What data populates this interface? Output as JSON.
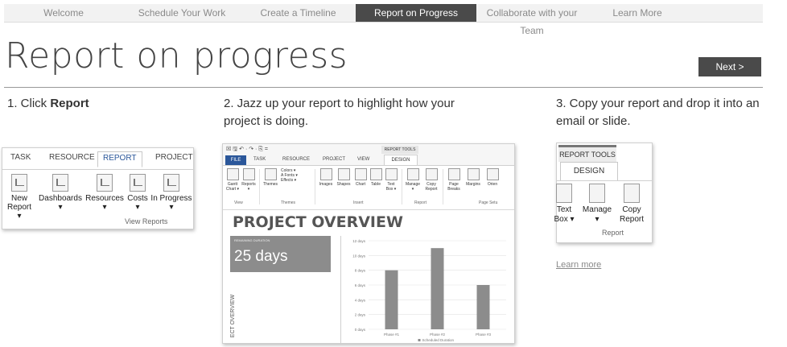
{
  "nav": {
    "tabs": [
      {
        "label": "Welcome"
      },
      {
        "label": "Schedule Your Work"
      },
      {
        "label": "Create a Timeline"
      },
      {
        "label": "Report on Progress",
        "active": true
      },
      {
        "label": "Collaborate with your Team"
      },
      {
        "label": "Learn More"
      }
    ]
  },
  "page": {
    "title": "Report on progress",
    "next_label": "Next >"
  },
  "steps": {
    "s1_prefix": "1. Click ",
    "s1_bold": "Report",
    "s2_line1": "2. Jazz up your report to highlight how your",
    "s2_line2": "project is doing.",
    "s3_line1": "3. Copy your report and drop it into an",
    "s3_line2": "email or slide."
  },
  "ribbon1": {
    "tabs": [
      "TASK",
      "RESOURCE",
      "REPORT",
      "PROJECT"
    ],
    "buttons": [
      {
        "line1": "New",
        "line2": "Report ▾"
      },
      {
        "line1": "Dashboards",
        "line2": "▾"
      },
      {
        "line1": "Resources",
        "line2": "▾"
      },
      {
        "line1": "Costs",
        "line2": "▾"
      },
      {
        "line1": "In Progress",
        "line2": "▾"
      }
    ],
    "group_label": "View Reports"
  },
  "shot2": {
    "qat": "☒ 🖫 ↶ · ↷ · ⎘ =",
    "report_tools": "REPORT TOOLS",
    "tabs": [
      "FILE",
      "TASK",
      "RESOURCE",
      "PROJECT",
      "VIEW",
      "DESIGN"
    ],
    "ribbon_buttons": [
      {
        "line1": "Gantt",
        "line2": "Chart ▾"
      },
      {
        "line1": "Reports",
        "line2": "▾"
      },
      {
        "line1": "Themes",
        "line2": ""
      },
      {
        "line1": "Colors ▾",
        "line2": "A Fonts ▾"
      },
      {
        "line1": "Effects ▾",
        "line2": ""
      },
      {
        "line1": "Images",
        "line2": ""
      },
      {
        "line1": "Shapes",
        "line2": ""
      },
      {
        "line1": "Chart",
        "line2": ""
      },
      {
        "line1": "Table",
        "line2": ""
      },
      {
        "line1": "Text",
        "line2": "Box ▾"
      },
      {
        "line1": "Manage",
        "line2": "▾"
      },
      {
        "line1": "Copy",
        "line2": "Report"
      },
      {
        "line1": "Page",
        "line2": "Breaks"
      },
      {
        "line1": "Margins",
        "line2": ""
      },
      {
        "line1": "Orien",
        "line2": ""
      }
    ],
    "groups": [
      "View",
      "Themes",
      "Insert",
      "Report",
      "Page Setu"
    ],
    "report_title": "PROJECT OVERVIEW",
    "duration_label": "REMAINING DURATION",
    "duration_value": "25 days",
    "vertical_label": "ECT OVERVIEW"
  },
  "chart_data": {
    "type": "bar",
    "categories": [
      "Phase #1",
      "Phase #2",
      "Phase #3"
    ],
    "series": [
      {
        "name": "Scheduled Duration",
        "values": [
          8,
          11,
          6
        ]
      }
    ],
    "ylim": [
      0,
      12
    ],
    "yticks": [
      "0 days",
      "2 days",
      "4 days",
      "6 days",
      "8 days",
      "10 days",
      "12 days"
    ],
    "bar_color": "#8c8c8c",
    "grid": true,
    "legend": "bottom"
  },
  "ribbon3": {
    "report_tools": "REPORT TOOLS",
    "design": "DESIGN",
    "buttons": [
      {
        "line1": "Text",
        "line2": "Box ▾"
      },
      {
        "line1": "Manage",
        "line2": "▾"
      },
      {
        "line1": "Copy",
        "line2": "Report"
      }
    ],
    "group_label": "Report"
  },
  "learn_more": "Learn more"
}
